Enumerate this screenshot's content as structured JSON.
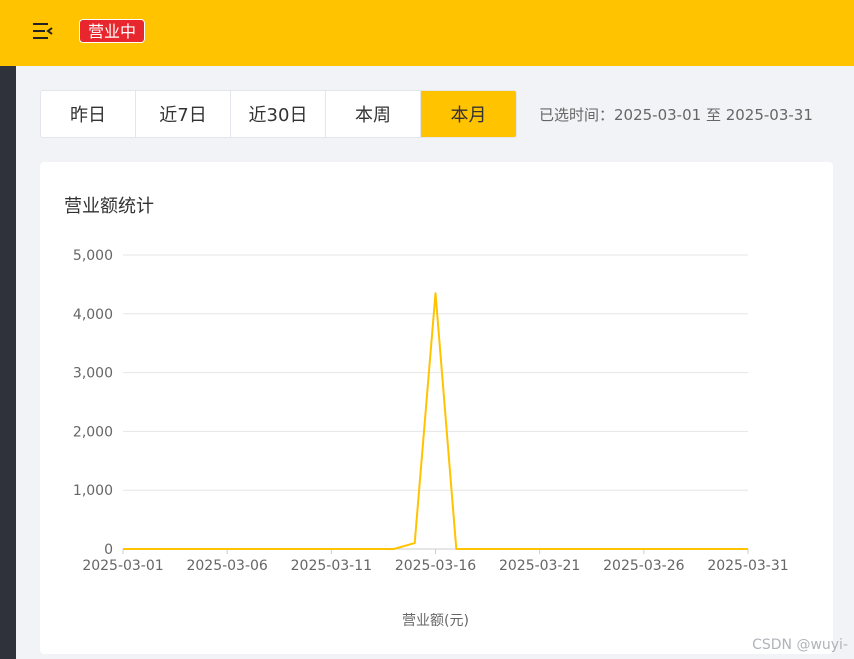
{
  "header": {
    "menu_icon": "menu-fold-icon",
    "status_badge": "营业中",
    "brand_color": "#ffc300",
    "badge_color": "#e8262d"
  },
  "filters": {
    "tabs": [
      {
        "label": "昨日",
        "active": false
      },
      {
        "label": "近7日",
        "active": false
      },
      {
        "label": "近30日",
        "active": false
      },
      {
        "label": "本周",
        "active": false
      },
      {
        "label": "本月",
        "active": true
      }
    ],
    "selected_range": "已选时间：2025-03-01 至 2025-03-31"
  },
  "card": {
    "title": "营业额统计"
  },
  "watermark": "CSDN @wuyi-",
  "chart_data": {
    "type": "line",
    "xlabel": "营业额(元)",
    "ylabel": "",
    "ylim": [
      0,
      5000
    ],
    "yticks": [
      "0",
      "1,000",
      "2,000",
      "3,000",
      "4,000",
      "5,000"
    ],
    "x_tick_labels": [
      "2025-03-01",
      "2025-03-06",
      "2025-03-11",
      "2025-03-16",
      "2025-03-21",
      "2025-03-26",
      "2025-03-31"
    ],
    "x": [
      "2025-03-01",
      "2025-03-02",
      "2025-03-03",
      "2025-03-04",
      "2025-03-05",
      "2025-03-06",
      "2025-03-07",
      "2025-03-08",
      "2025-03-09",
      "2025-03-10",
      "2025-03-11",
      "2025-03-12",
      "2025-03-13",
      "2025-03-14",
      "2025-03-15",
      "2025-03-16",
      "2025-03-17",
      "2025-03-18",
      "2025-03-19",
      "2025-03-20",
      "2025-03-21",
      "2025-03-22",
      "2025-03-23",
      "2025-03-24",
      "2025-03-25",
      "2025-03-26",
      "2025-03-27",
      "2025-03-28",
      "2025-03-29",
      "2025-03-30",
      "2025-03-31"
    ],
    "series": [
      {
        "values": [
          0,
          0,
          0,
          0,
          0,
          0,
          0,
          0,
          0,
          0,
          0,
          0,
          0,
          0,
          100,
          4350,
          0,
          0,
          0,
          0,
          0,
          0,
          0,
          0,
          0,
          0,
          0,
          0,
          0,
          0,
          0
        ],
        "color": "#ffc300"
      }
    ],
    "grid": true
  }
}
